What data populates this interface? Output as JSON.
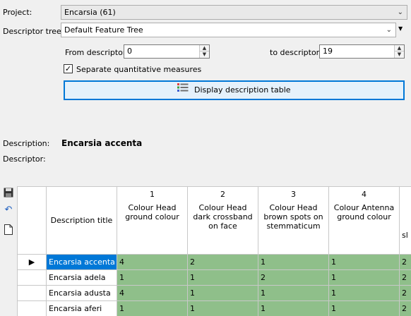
{
  "project": {
    "label": "Project:",
    "value": "Encarsia (61)"
  },
  "descriptor_tree": {
    "label": "Descriptor tree:",
    "value": "Default Feature Tree"
  },
  "from_descriptor": {
    "label": "From descriptor:",
    "value": "0"
  },
  "to_descriptor": {
    "label": "to descriptor:",
    "value": "19"
  },
  "separate_quantitative": {
    "label": "Separate quantitative measures",
    "checked": true
  },
  "display_button": {
    "label": "Display description table"
  },
  "description": {
    "label": "Description:",
    "value": "Encarsia accenta"
  },
  "descriptor": {
    "label": "Descriptor:"
  },
  "table": {
    "title_header": "Description title",
    "columns": [
      {
        "num": "1",
        "name": "Colour Head ground colour"
      },
      {
        "num": "2",
        "name": "Colour Head dark crossband on face"
      },
      {
        "num": "3",
        "name": "Colour Head brown spots on stemmaticum"
      },
      {
        "num": "4",
        "name": "Colour Antenna ground colour"
      },
      {
        "num": "",
        "name": "sl"
      }
    ],
    "rows": [
      {
        "title": "Encarsia accenta",
        "values": [
          "4",
          "2",
          "1",
          "1",
          "2"
        ],
        "selected": true
      },
      {
        "title": "Encarsia adela",
        "values": [
          "1",
          "1",
          "2",
          "1",
          "2"
        ],
        "selected": false
      },
      {
        "title": "Encarsia adusta",
        "values": [
          "4",
          "1",
          "1",
          "1",
          "2"
        ],
        "selected": false
      },
      {
        "title": "Encarsia aferi",
        "values": [
          "1",
          "1",
          "1",
          "1",
          "2"
        ],
        "selected": false
      }
    ]
  },
  "colors": {
    "accent": "#0078d7",
    "cell_green": "#8fbf8a"
  },
  "icons": [
    "save-icon",
    "undo-icon",
    "new-document-icon",
    "grid-icon"
  ]
}
